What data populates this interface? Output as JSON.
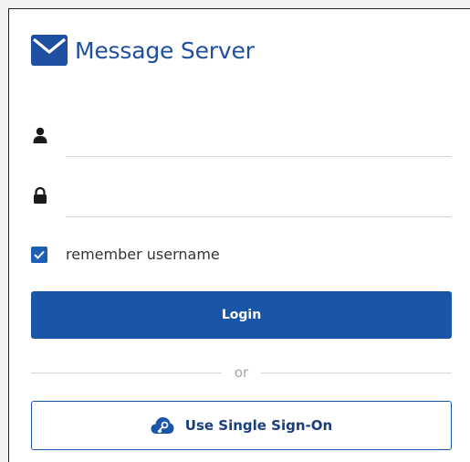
{
  "header": {
    "title": "Message Server",
    "logo_icon": "envelope-icon"
  },
  "form": {
    "username": {
      "icon": "user-icon",
      "value": "",
      "placeholder": ""
    },
    "password": {
      "icon": "lock-icon",
      "value": "",
      "placeholder": ""
    },
    "remember": {
      "label": "remember username",
      "checked": true
    },
    "login_label": "Login",
    "divider_text": "or",
    "sso_label": "Use Single Sign-On",
    "sso_icon": "cloud-key-icon"
  },
  "colors": {
    "primary": "#1a56a8",
    "title": "#1e4fa1",
    "sso_text": "#1a3e79",
    "divider": "#d6d6d6"
  }
}
